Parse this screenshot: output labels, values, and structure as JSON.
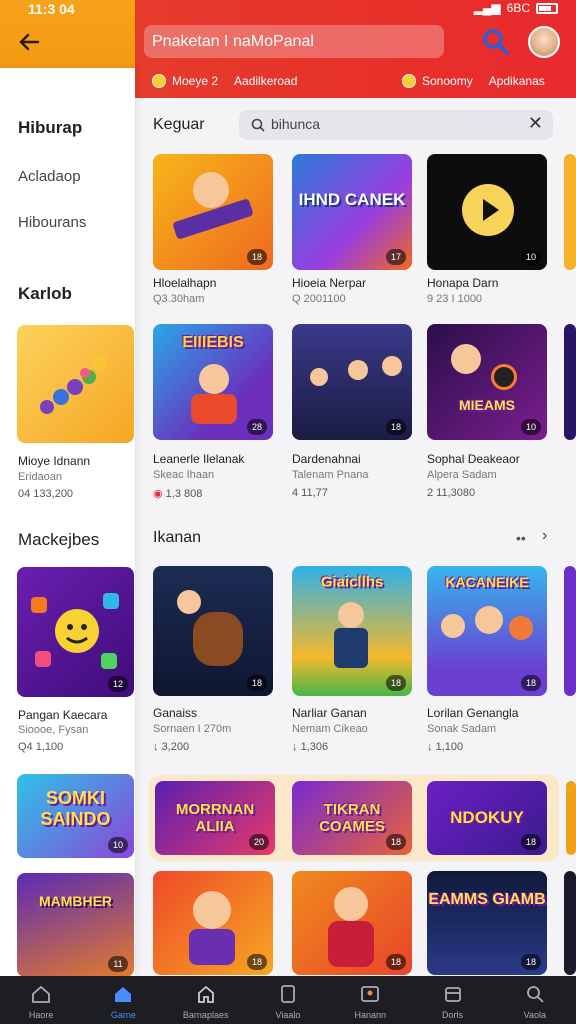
{
  "status": {
    "time": "11:3 04",
    "carrier": "6BC"
  },
  "header": {
    "search_value": "Pnaketan I naMoPanal",
    "subnav": [
      {
        "a": "Moeye 2",
        "b": "Aadilkeroad"
      },
      {
        "a": "Sonoomy",
        "b": "Apdikanas"
      }
    ]
  },
  "sidebar": {
    "heading1": "Hiburap",
    "items": [
      "Acladaop",
      "Hibourans"
    ],
    "heading2": "Karlob",
    "card1": {
      "title": "Mioye Idnann",
      "sub": "Eridaoan",
      "stat": "04 133,200"
    },
    "heading3": "Mackejbes",
    "card2": {
      "title": "Pangan Kaecara",
      "sub": "Sioooe, Fysan",
      "stat": "Q4 1,100"
    }
  },
  "main": {
    "section1": "Keguar",
    "search": {
      "value": "bihunca",
      "clear": "✕"
    },
    "row1": [
      {
        "title": "Hloelalhapn",
        "sub": "Q3.30ham",
        "badge": "18"
      },
      {
        "title": "Hioeia Nerpar",
        "sub": "Q 2001100",
        "badge": "17",
        "logo": "IHND CANEK"
      },
      {
        "title": "Honapa Darn",
        "sub": "9 23 I 1000",
        "badge": "10"
      }
    ],
    "row2": [
      {
        "title": "Leanerle Ilelanak",
        "sub": "Skeac Ihaan",
        "stat": "1,3 808",
        "badge": "28",
        "logo": "EIIIEBIS"
      },
      {
        "title": "Dardenahnai",
        "sub": "Talenam Pnana",
        "stat": "4 11,77",
        "badge": "18"
      },
      {
        "title": "Sophal Deakeaor",
        "sub": "Alpera Sadam",
        "stat": "2 11,3080",
        "badge": "10",
        "logo": "MIEAMS"
      }
    ],
    "section2": "Ikanan",
    "row3": [
      {
        "title": "Ganaiss",
        "sub": "Sornaen I 270m",
        "stat": "3,200",
        "badge": "18"
      },
      {
        "title": "Narliar Ganan",
        "sub": "Nemam Cikeao",
        "stat": "1,306",
        "badge": "18",
        "logo": "Giaicllhs"
      },
      {
        "title": "Lorilan Genangla",
        "sub": "Sonak Sadam",
        "stat": "1,100",
        "badge": "18",
        "logo": "KACANEIKE"
      }
    ],
    "row4": [
      {
        "badge": "10",
        "logo": "SOMKI SAINDO"
      },
      {
        "badge": "20",
        "logo": "MORRNAN ALIIA"
      },
      {
        "badge": "18",
        "logo": "TIKRAN COAMES"
      },
      {
        "badge": "18",
        "logo": "NDOKUY"
      }
    ],
    "row5": [
      {
        "badge": "11",
        "logo": "MAMBHER"
      },
      {
        "badge": "18"
      },
      {
        "badge": "18"
      },
      {
        "badge": "18",
        "logo": "EAMMS GIAMB"
      }
    ]
  },
  "bottom_nav": [
    "Haore",
    "Garne",
    "Barnaplaes",
    "Viaalo",
    "Hanann",
    "Dorls",
    "Vaola"
  ]
}
